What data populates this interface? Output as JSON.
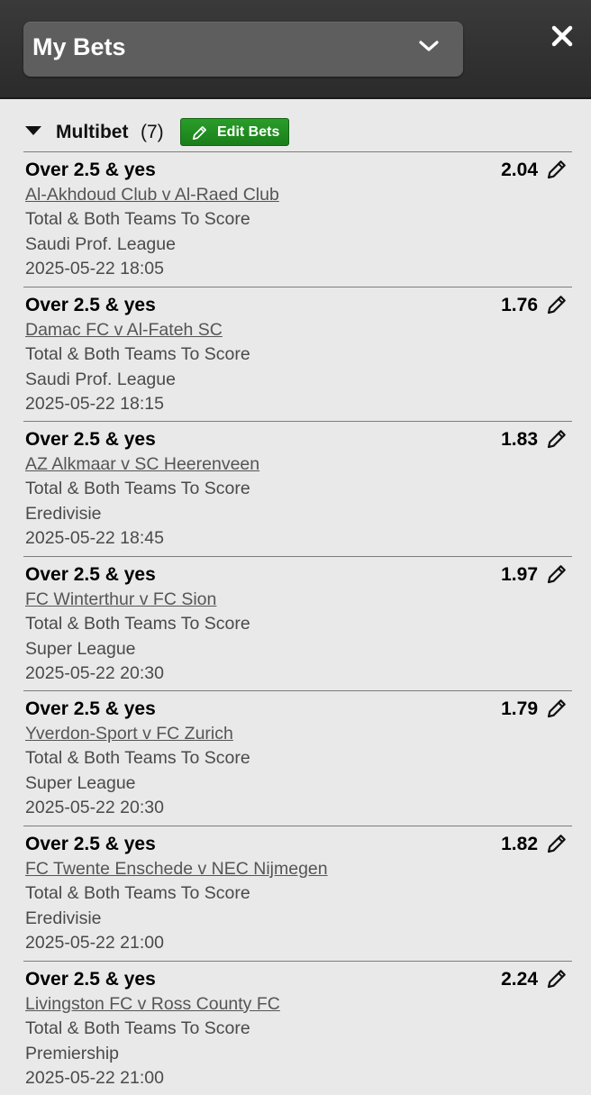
{
  "header": {
    "title": "My Bets",
    "dropdown_icon": "chevron-down-icon",
    "close_icon": "close-icon"
  },
  "multibet": {
    "label": "Multibet",
    "count": "(7)",
    "edit_label": "Edit Bets",
    "collapse_icon": "triangle-down-icon"
  },
  "bets": [
    {
      "selection": "Over 2.5 & yes",
      "odds": "2.04",
      "event": "Al-Akhdoud Club v Al-Raed Club",
      "market": "Total & Both Teams To Score",
      "league": "Saudi Prof. League",
      "time": "2025-05-22 18:05"
    },
    {
      "selection": "Over 2.5 & yes",
      "odds": "1.76",
      "event": "Damac FC v Al-Fateh SC",
      "market": "Total & Both Teams To Score",
      "league": "Saudi Prof. League",
      "time": "2025-05-22 18:15"
    },
    {
      "selection": "Over 2.5 & yes",
      "odds": "1.83",
      "event": "AZ Alkmaar v SC Heerenveen",
      "market": "Total & Both Teams To Score",
      "league": "Eredivisie",
      "time": "2025-05-22 18:45"
    },
    {
      "selection": "Over 2.5 & yes",
      "odds": "1.97",
      "event": "FC Winterthur v FC Sion",
      "market": "Total & Both Teams To Score",
      "league": "Super League",
      "time": "2025-05-22 20:30"
    },
    {
      "selection": "Over 2.5 & yes",
      "odds": "1.79",
      "event": "Yverdon-Sport v FC Zurich",
      "market": "Total & Both Teams To Score",
      "league": "Super League",
      "time": "2025-05-22 20:30"
    },
    {
      "selection": "Over 2.5 & yes",
      "odds": "1.82",
      "event": "FC Twente Enschede v NEC Nijmegen",
      "market": "Total & Both Teams To Score",
      "league": "Eredivisie",
      "time": "2025-05-22 21:00"
    },
    {
      "selection": "Over 2.5 & yes",
      "odds": "2.24",
      "event": "Livingston FC v Ross County FC",
      "market": "Total & Both Teams To Score",
      "league": "Premiership",
      "time": "2025-05-22 21:00"
    }
  ],
  "colors": {
    "header_bg": "#2f2f2f",
    "select_bg": "#5e5e5e",
    "accent_green": "#1f8c1f",
    "content_bg": "#e9e9e9"
  }
}
